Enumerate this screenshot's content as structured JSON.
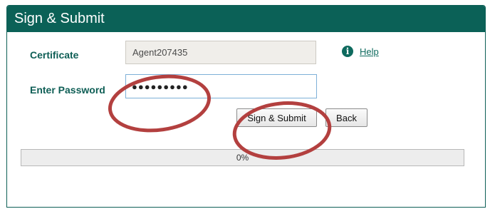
{
  "window": {
    "title": "Sign & Submit"
  },
  "form": {
    "certificate_label": "Certificate",
    "certificate_value": "Agent207435",
    "password_label": "Enter Password",
    "password_value": "●●●●●●●●●",
    "help_label": "Help",
    "help_icon": "info-icon"
  },
  "actions": {
    "submit_label": "Sign & Submit",
    "back_label": "Back"
  },
  "progress": {
    "percent": 0,
    "label": "0%"
  },
  "colors": {
    "header_bg": "#0b6157",
    "label_text": "#0e5e55",
    "annotation": "#b3403f"
  }
}
